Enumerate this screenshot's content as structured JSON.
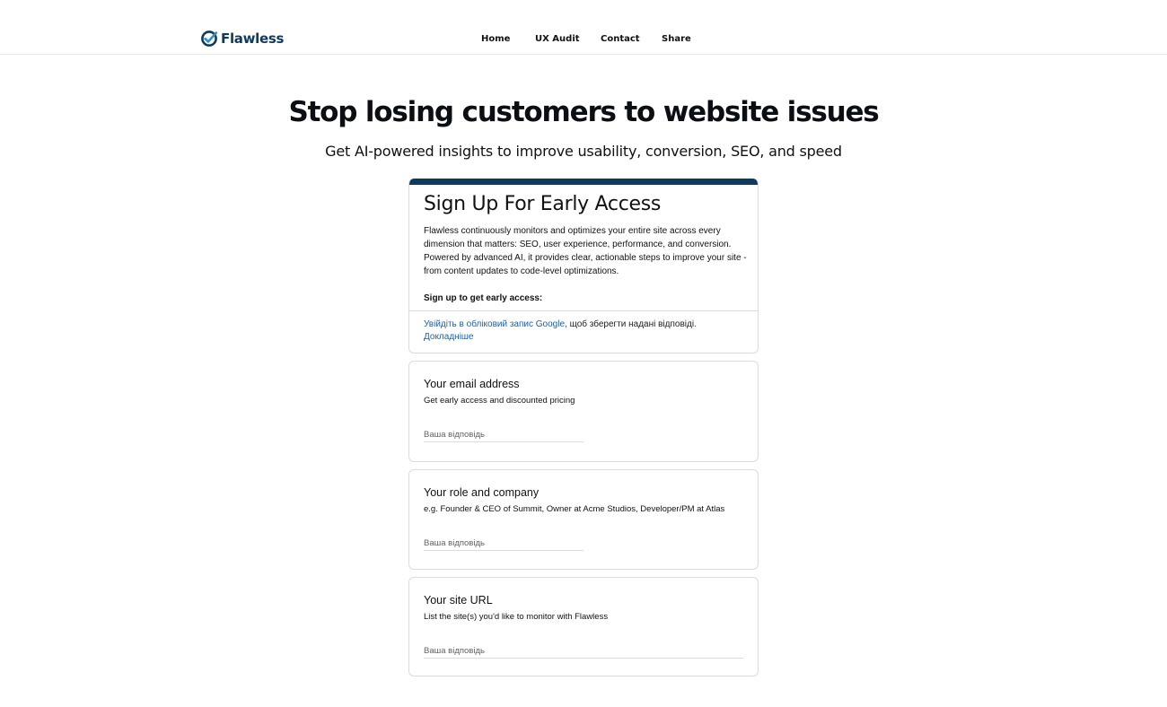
{
  "brand": {
    "name": "Flawless",
    "logo_icon": "check-circle-icon",
    "color": "#0e3a5c"
  },
  "nav": {
    "items": [
      {
        "label": "Home"
      },
      {
        "label": "UX Audit"
      },
      {
        "label": "Contact"
      },
      {
        "label": "Share"
      }
    ]
  },
  "hero": {
    "title": "Stop losing customers to website issues",
    "subtitle": "Get AI-powered insights to improve usability, conversion, SEO, and speed"
  },
  "form": {
    "title": "Sign Up For Early Access",
    "description": "Flawless continuously monitors and optimizes your entire site across every dimension that matters: SEO, user experience, performance, and conversion. Powered by advanced AI, it provides clear, actionable steps to improve your site - from content updates to code-level optimizations.",
    "lead_in": "Sign up to get early access:",
    "signin_link": "Увійдіть в обліковий запис Google",
    "signin_text": ", щоб зберегти надані відповіді.",
    "learn_more": "Докладніше",
    "accent_color": "#0e3a5c"
  },
  "questions": [
    {
      "title": "Your email address",
      "help": "Get early access and discounted pricing",
      "placeholder": "Ваша відповідь",
      "value": ""
    },
    {
      "title": "Your role and company",
      "help": "e.g. Founder & CEO of Summit, Owner at Acme Studios, Developer/PM at Atlas",
      "placeholder": "Ваша відповідь",
      "value": ""
    },
    {
      "title": "Your site URL",
      "help": "List the site(s) you'd like to monitor with Flawless",
      "placeholder": "Ваша відповідь",
      "value": ""
    }
  ]
}
